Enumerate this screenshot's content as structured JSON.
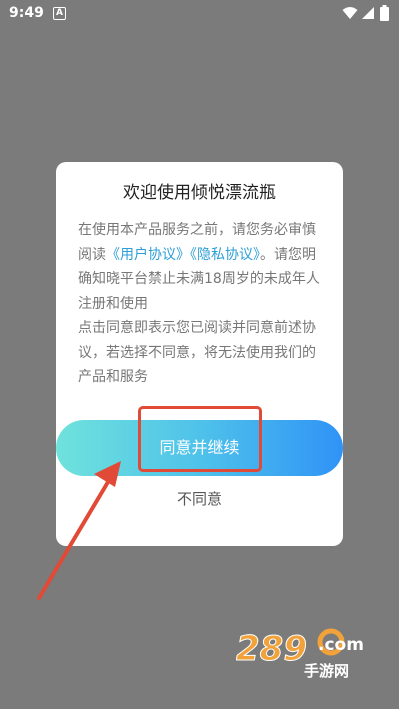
{
  "status_bar": {
    "time": "9:49",
    "notification_icon": "A"
  },
  "dialog": {
    "title": "欢迎使用倾悦漂流瓶",
    "para1_prefix": "在使用本产品服务之前，请您务必审慎阅读",
    "user_agreement_link": "《用户协议》",
    "privacy_link": "《隐私协议》",
    "para1_suffix": "。请您明确知晓平台禁止未满18周岁的未成年人注册和使用",
    "para2": "点击同意即表示您已阅读并同意前述协议，若选择不同意，将无法使用我们的产品和服务",
    "agree_label": "同意并继续",
    "disagree_label": "不同意"
  },
  "watermark": {
    "brand": "289",
    "suffix": ".com",
    "sub": "手游网"
  },
  "colors": {
    "overlay": "#7b7b7b",
    "link": "#2e9fd6",
    "annotation": "#e04a36",
    "button_gradient_start": "#6fe2dc",
    "button_gradient_end": "#2f93f6"
  }
}
